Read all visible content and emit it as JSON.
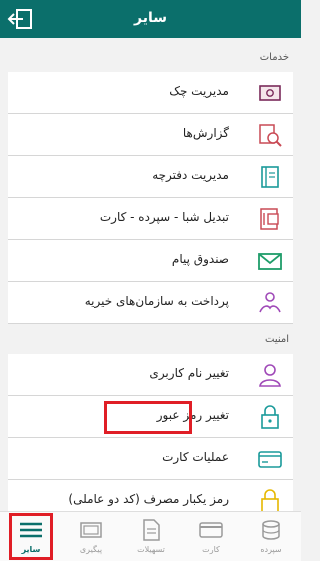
{
  "header": {
    "title": "سایر",
    "back_icon": "logout-icon"
  },
  "sections": {
    "services": "خدمات",
    "security": "امنیت"
  },
  "services_items": [
    {
      "label": "مدیریت چک",
      "icon": "cheque-icon"
    },
    {
      "label": "گزارش‌ها",
      "icon": "report-search-icon"
    },
    {
      "label": "مدیریت دفترچه",
      "icon": "notebook-icon"
    },
    {
      "label": "تبدیل شبا - سپرده - کارت",
      "icon": "iban-convert-icon"
    },
    {
      "label": "صندوق پیام",
      "icon": "mail-icon"
    },
    {
      "label": "پرداخت به سازمان‌های خیریه",
      "icon": "charity-icon"
    }
  ],
  "security_items": [
    {
      "label": "تغییر نام کاربری",
      "icon": "user-icon"
    },
    {
      "label": "تغییر رمز عبور",
      "icon": "lock-icon"
    },
    {
      "label": "عملیات کارت",
      "icon": "card-icon"
    },
    {
      "label": "رمز یکبار مصرف (کد دو عاملی)",
      "icon": "otp-lock-icon"
    }
  ],
  "bottom_nav": [
    {
      "label": "سایر",
      "icon": "menu-icon",
      "active": true
    },
    {
      "label": "پیگیری",
      "icon": "tracking-icon",
      "active": false
    },
    {
      "label": "تسهیلات",
      "icon": "loan-document-icon",
      "active": false
    },
    {
      "label": "کارت",
      "icon": "card-icon",
      "active": false
    },
    {
      "label": "سپرده",
      "icon": "coins-icon",
      "active": false
    }
  ],
  "colors": {
    "primary": "#0b6f6b",
    "highlight": "#e01e26",
    "icon_red": "#c94a55",
    "icon_green": "#1f9d6a",
    "icon_purple": "#a04ab8",
    "icon_teal": "#1a9a9a",
    "icon_yellow": "#e6b800"
  }
}
